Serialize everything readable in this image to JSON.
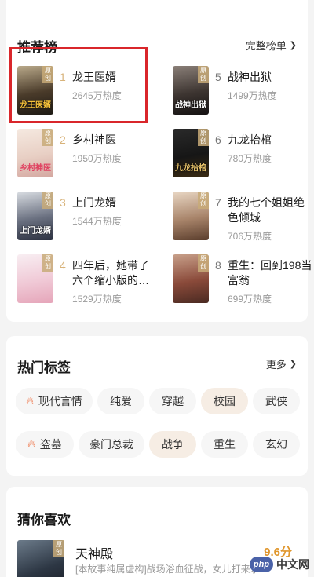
{
  "ranking": {
    "title": "推荐榜",
    "more_label": "完整榜单",
    "books": [
      {
        "rank": "1",
        "title": "龙王医婿",
        "heat": "2645万热度",
        "cover_text": "龙王医婿",
        "cover_badge": "原创"
      },
      {
        "rank": "2",
        "title": "乡村神医",
        "heat": "1950万热度",
        "cover_text": "乡村神医",
        "cover_badge": "原创"
      },
      {
        "rank": "3",
        "title": "上门龙婿",
        "heat": "1544万热度",
        "cover_text": "上门龙婿",
        "cover_badge": "原创"
      },
      {
        "rank": "4",
        "title": "四年后，她带了六个缩小版的…",
        "heat": "1529万热度",
        "cover_text": "",
        "cover_badge": "原创"
      },
      {
        "rank": "5",
        "title": "战神出狱",
        "heat": "1499万热度",
        "cover_text": "战神出狱",
        "cover_badge": "原创"
      },
      {
        "rank": "6",
        "title": "九龙抬棺",
        "heat": "780万热度",
        "cover_text": "九龙抬棺",
        "cover_badge": "原创"
      },
      {
        "rank": "7",
        "title": "我的七个姐姐绝色倾城",
        "heat": "706万热度",
        "cover_text": "",
        "cover_badge": "原创"
      },
      {
        "rank": "8",
        "title": "重生：回到198当富翁",
        "heat": "699万热度",
        "cover_text": "",
        "cover_badge": "原创"
      }
    ]
  },
  "hot_tags": {
    "title": "热门标签",
    "more_label": "更多",
    "row1": [
      "现代言情",
      "纯爱",
      "穿越",
      "校园",
      "武侠"
    ],
    "row2": [
      "盗墓",
      "豪门总裁",
      "战争",
      "重生",
      "玄幻"
    ]
  },
  "guess": {
    "title": "猜你喜欢",
    "book_title": "天神殿",
    "score": "9.6分",
    "desc": "[本故事纯属虚构]战场浴血征战，女儿打来求救",
    "cover_badge": "原创"
  },
  "watermark": {
    "logo": "php",
    "text": "中文网"
  },
  "colors": {
    "highlight": "#d9262b",
    "gold": "#d8b37a",
    "score": "#e0962c"
  }
}
